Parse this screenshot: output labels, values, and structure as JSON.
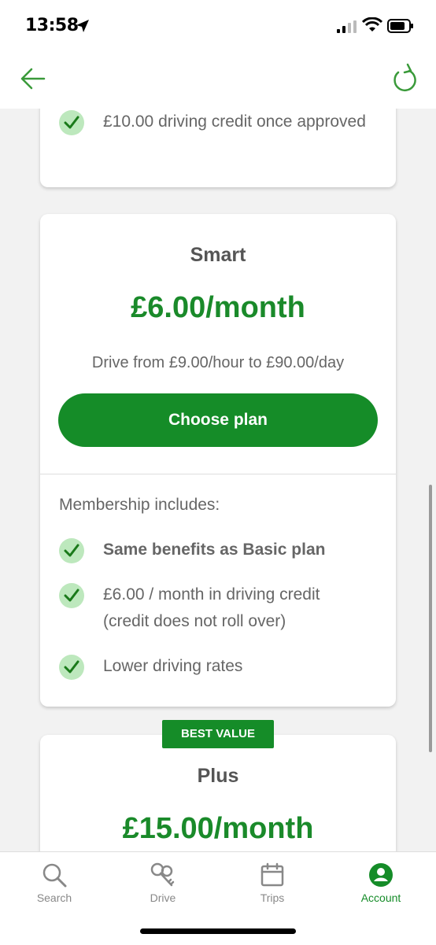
{
  "status": {
    "time": "13:58"
  },
  "colors": {
    "accent": "#158c28",
    "check_bg": "#bde8bd"
  },
  "top_card": {
    "features": [
      {
        "text": "£10.00 driving credit once approved",
        "bold": false
      }
    ]
  },
  "smart_plan": {
    "name": "Smart",
    "price": "£6.00/month",
    "rates": "Drive from £9.00/hour to £90.00/day",
    "button_label": "Choose plan",
    "membership_label": "Membership includes:",
    "features": [
      {
        "text": "Same benefits as Basic plan",
        "bold": true
      },
      {
        "text": "£6.00 / month in driving credit (credit does not roll over)",
        "bold": false
      },
      {
        "text": "Lower driving rates",
        "bold": false
      }
    ]
  },
  "plus_plan": {
    "badge": "BEST VALUE",
    "name": "Plus",
    "price": "£15.00/month"
  },
  "tabs": [
    {
      "label": "Search",
      "icon": "search-icon",
      "active": false
    },
    {
      "label": "Drive",
      "icon": "keys-icon",
      "active": false
    },
    {
      "label": "Trips",
      "icon": "calendar-icon",
      "active": false
    },
    {
      "label": "Account",
      "icon": "account-icon",
      "active": true
    }
  ]
}
